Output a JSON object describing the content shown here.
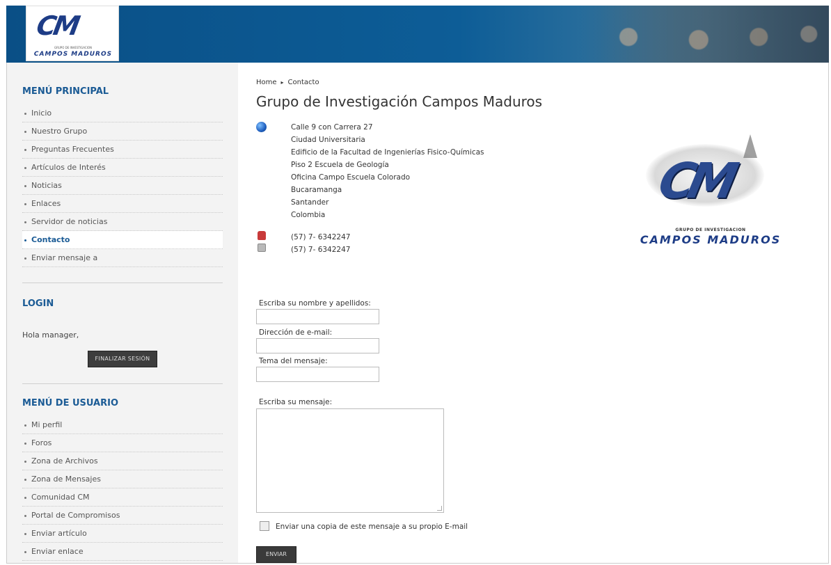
{
  "header": {
    "logo_mark": "CM",
    "logo_tagline": "GRUPO DE INVESTIGACION",
    "logo_name": "CAMPOS MADUROS"
  },
  "sidebar": {
    "main_menu_title": "MENÚ PRINCIPAL",
    "main_menu": [
      {
        "label": "Inicio",
        "active": false
      },
      {
        "label": "Nuestro Grupo",
        "active": false
      },
      {
        "label": "Preguntas Frecuentes",
        "active": false
      },
      {
        "label": "Artículos de Interés",
        "active": false
      },
      {
        "label": "Noticias",
        "active": false
      },
      {
        "label": "Enlaces",
        "active": false
      },
      {
        "label": "Servidor de noticias",
        "active": false
      },
      {
        "label": "Contacto",
        "active": true
      },
      {
        "label": "Enviar mensaje a",
        "active": false
      }
    ],
    "login_title": "LOGIN",
    "greeting": "Hola manager,",
    "logout_label": "FINALIZAR SESIÓN",
    "user_menu_title": "MENÚ DE USUARIO",
    "user_menu": [
      {
        "label": "Mi perfil"
      },
      {
        "label": "Foros"
      },
      {
        "label": "Zona de Archivos"
      },
      {
        "label": "Zona de Mensajes"
      },
      {
        "label": "Comunidad CM"
      },
      {
        "label": "Portal de Compromisos"
      },
      {
        "label": "Enviar artículo"
      },
      {
        "label": "Enviar enlace"
      }
    ]
  },
  "main": {
    "breadcrumb": {
      "home": "Home",
      "sep": "▸",
      "current": "Contacto"
    },
    "title": "Grupo de Investigación Campos Maduros",
    "address_lines": [
      "Calle 9 con Carrera 27",
      "Ciudad Universitaria",
      "Edificio de la Facultad de Ingenierías Fisico-Químicas",
      "Piso 2 Escuela de Geología",
      "Oficina Campo Escuela Colorado",
      "Bucaramanga",
      "Santander",
      "Colombia"
    ],
    "phone": "(57) 7- 6342247",
    "fax": "(57) 7- 6342247",
    "big_logo_tagline": "GRUPO DE INVESTIGACION",
    "big_logo_name": "CAMPOS MADUROS"
  },
  "form": {
    "name_label": "Escriba su nombre y apellidos:",
    "name_value": "",
    "email_label": "Dirección de e-mail:",
    "email_value": "",
    "subject_label": "Tema del mensaje:",
    "subject_value": "",
    "message_label": "Escriba su mensaje:",
    "message_value": "",
    "copy_label": "Enviar una copia de este mensaje a su propio E-mail",
    "copy_checked": false,
    "send_label": "ENVIAR"
  }
}
